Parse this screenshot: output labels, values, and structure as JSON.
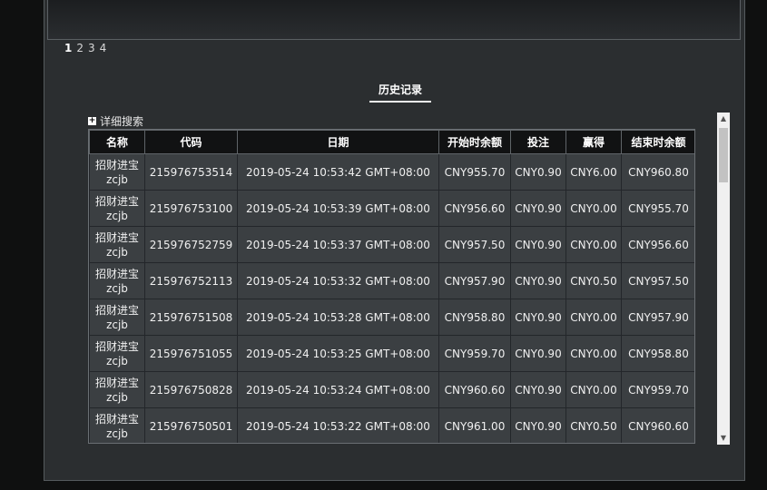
{
  "pagination": {
    "pages": [
      "1",
      "2",
      "3",
      "4"
    ],
    "active": "1"
  },
  "history_title": "历史记录",
  "search_toggle_label": "详细搜索",
  "table": {
    "headers": [
      "名称",
      "代码",
      "日期",
      "开始时余额",
      "投注",
      "赢得",
      "结束时余额"
    ],
    "rows": [
      {
        "name": "招财进宝",
        "code_short": "zcjb",
        "id": "215976753514",
        "date": "2019-05-24 10:53:42 GMT+08:00",
        "start": "CNY955.70",
        "bet": "CNY0.90",
        "win": "CNY6.00",
        "end": "CNY960.80"
      },
      {
        "name": "招财进宝",
        "code_short": "zcjb",
        "id": "215976753100",
        "date": "2019-05-24 10:53:39 GMT+08:00",
        "start": "CNY956.60",
        "bet": "CNY0.90",
        "win": "CNY0.00",
        "end": "CNY955.70"
      },
      {
        "name": "招财进宝",
        "code_short": "zcjb",
        "id": "215976752759",
        "date": "2019-05-24 10:53:37 GMT+08:00",
        "start": "CNY957.50",
        "bet": "CNY0.90",
        "win": "CNY0.00",
        "end": "CNY956.60"
      },
      {
        "name": "招财进宝",
        "code_short": "zcjb",
        "id": "215976752113",
        "date": "2019-05-24 10:53:32 GMT+08:00",
        "start": "CNY957.90",
        "bet": "CNY0.90",
        "win": "CNY0.50",
        "end": "CNY957.50"
      },
      {
        "name": "招财进宝",
        "code_short": "zcjb",
        "id": "215976751508",
        "date": "2019-05-24 10:53:28 GMT+08:00",
        "start": "CNY958.80",
        "bet": "CNY0.90",
        "win": "CNY0.00",
        "end": "CNY957.90"
      },
      {
        "name": "招财进宝",
        "code_short": "zcjb",
        "id": "215976751055",
        "date": "2019-05-24 10:53:25 GMT+08:00",
        "start": "CNY959.70",
        "bet": "CNY0.90",
        "win": "CNY0.00",
        "end": "CNY958.80"
      },
      {
        "name": "招财进宝",
        "code_short": "zcjb",
        "id": "215976750828",
        "date": "2019-05-24 10:53:24 GMT+08:00",
        "start": "CNY960.60",
        "bet": "CNY0.90",
        "win": "CNY0.00",
        "end": "CNY959.70"
      },
      {
        "name": "招财进宝",
        "code_short": "zcjb",
        "id": "215976750501",
        "date": "2019-05-24 10:53:22 GMT+08:00",
        "start": "CNY961.00",
        "bet": "CNY0.90",
        "win": "CNY0.50",
        "end": "CNY960.60"
      }
    ]
  },
  "icons": {
    "expand": "plus-box-icon",
    "scroll_up": "arrow-up-icon",
    "scroll_down": "arrow-down-icon"
  }
}
